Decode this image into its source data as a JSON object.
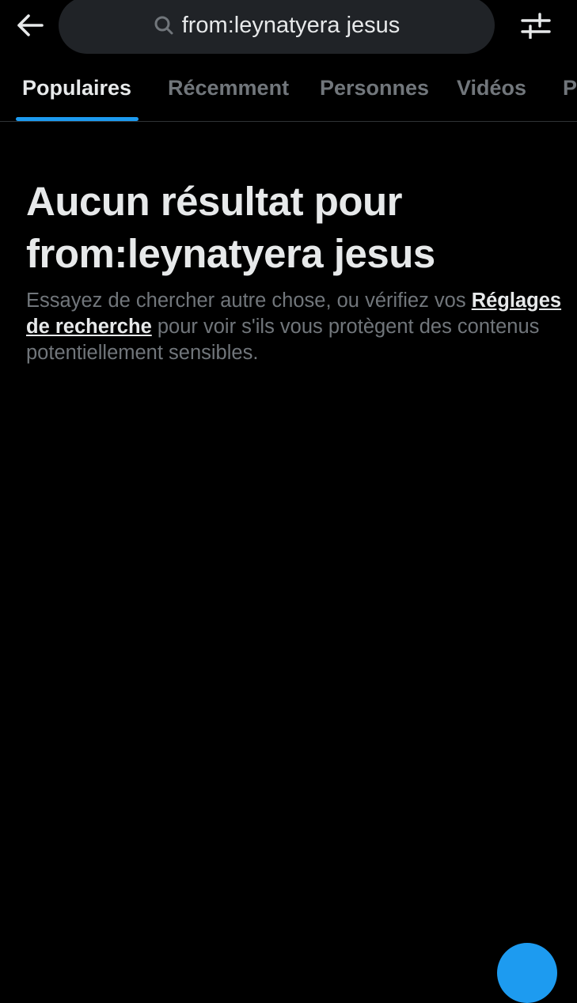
{
  "search": {
    "query": "from:leynatyera jesus"
  },
  "tabs": [
    {
      "label": "Populaires",
      "active": true
    },
    {
      "label": "Récemment",
      "active": false
    },
    {
      "label": "Personnes",
      "active": false
    },
    {
      "label": "Vidéos",
      "active": false
    },
    {
      "label": "P",
      "active": false
    }
  ],
  "empty_state": {
    "title": "Aucun résultat pour from:leynatyera jesus",
    "text_before": "Essayez de chercher autre chose, ou vérifiez vos ",
    "link_label": "Réglages de recherche",
    "text_after": " pour voir s'ils vous protègent des contenus potentiellement sensibles."
  },
  "colors": {
    "background": "#000000",
    "accent": "#1d9bf0",
    "primary_text": "#e7e9ea",
    "secondary_text": "#71767b",
    "search_field": "#202327"
  },
  "icons": {
    "back": "arrow-left-icon",
    "search": "search-icon",
    "filter": "sliders-icon"
  }
}
